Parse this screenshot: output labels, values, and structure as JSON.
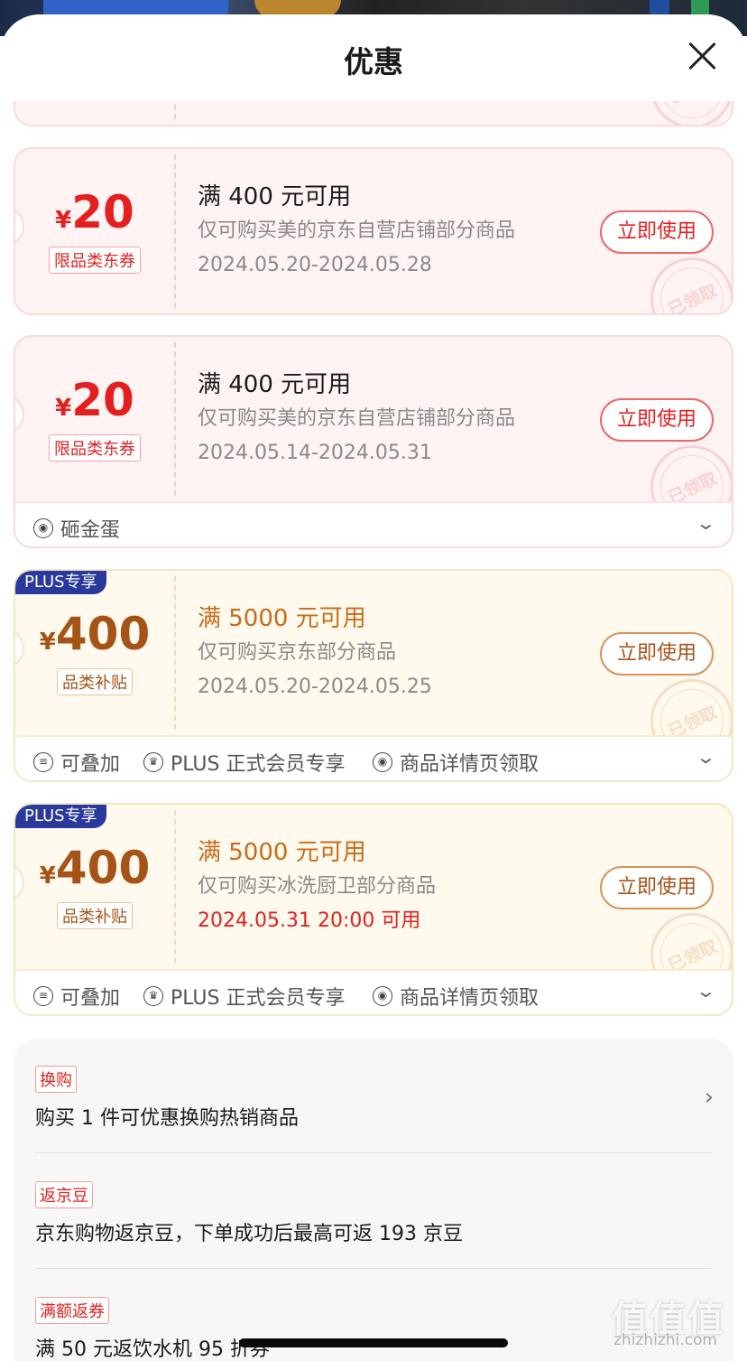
{
  "header": {
    "title": "优惠"
  },
  "coupons": [
    {
      "style": "red",
      "currency": "¥",
      "amount": "20",
      "tag": "限品类东券",
      "condition": "满 400 元可用",
      "description": "仅可购买美的京东自营店铺部分商品",
      "date": "2024.05.20-2024.05.28",
      "button": "立即使用",
      "stamp": "已领取"
    },
    {
      "style": "red",
      "currency": "¥",
      "amount": "20",
      "tag": "限品类东券",
      "condition": "满 400 元可用",
      "description": "仅可购买美的京东自营店铺部分商品",
      "date": "2024.05.14-2024.05.31",
      "button": "立即使用",
      "stamp": "已领取",
      "extras": [
        "砸金蛋"
      ]
    },
    {
      "style": "gold",
      "plus_badge": "PLUS专享",
      "currency": "¥",
      "amount": "400",
      "tag": "品类补贴",
      "condition": "满 5000 元可用",
      "description": "仅可购买京东部分商品",
      "date": "2024.05.20-2024.05.25",
      "button": "立即使用",
      "stamp": "已领取",
      "extras": [
        "可叠加",
        "PLUS 正式会员专享",
        "商品详情页领取"
      ]
    },
    {
      "style": "gold",
      "plus_badge": "PLUS专享",
      "currency": "¥",
      "amount": "400",
      "tag": "品类补贴",
      "condition": "满 5000 元可用",
      "description": "仅可购买冰洗厨卫部分商品",
      "date": "2024.05.31 20:00 可用",
      "button": "立即使用",
      "stamp": "已领取",
      "extras": [
        "可叠加",
        "PLUS 正式会员专享",
        "商品详情页领取"
      ]
    }
  ],
  "promos": [
    {
      "badge": "换购",
      "text": "购买 1 件可优惠换购热销商品"
    },
    {
      "badge": "返京豆",
      "text": "京东购物返京豆，下单成功后最高可返 193 京豆"
    },
    {
      "badge": "满额返券",
      "text": "满 50 元返饮水机 95 折券"
    }
  ],
  "watermark": {
    "logo": "值值值",
    "site": "zhizhizhi.com"
  },
  "colors": {
    "red": "#e41f1f",
    "gold": "#a65317",
    "plus": "#2a3a9c"
  }
}
